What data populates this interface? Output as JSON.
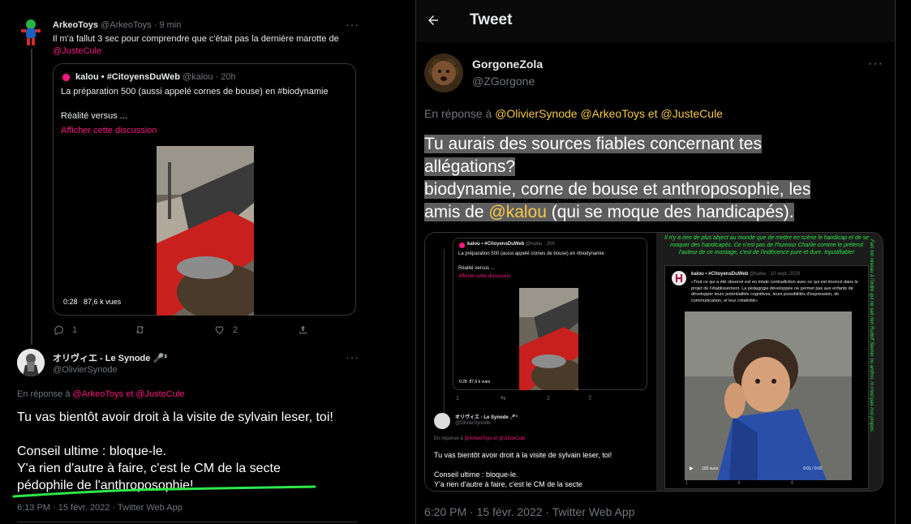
{
  "left": {
    "tweet1": {
      "author": "ArkeoToys",
      "handle": "@ArkeoToys",
      "time": "· 9 min",
      "text": "Il m'a fallut 3 sec pour comprendre que c'était pas la dernière marotte de",
      "mention": "@JusteCule"
    },
    "quote": {
      "author": "kalou • #CitoyensDuWeb",
      "handle": "@kalou · 20h",
      "line1": "La préparation 500 (aussi appelé cornes de bouse) en #biodynamie",
      "line2": "Réalité versus ...",
      "show_thread": "Afficher cette discussion",
      "video_time": "0:28",
      "video_views": "87,6 k vues"
    },
    "actions1": {
      "replies": "1",
      "likes": "2"
    },
    "tweet2": {
      "author": "オリヴィエ - Le Synode 🎤³",
      "handle": "@OlivierSynode",
      "reply_prefix": "En réponse à",
      "reply_m1": "@ArkeoToys",
      "reply_and": "et",
      "reply_m2": "@JusteCule",
      "line1": "Tu vas bientôt avoir droit à la visite de sylvain leser, toi!",
      "line2": "Conseil ultime : bloque-le.",
      "line3": "Y'a rien d'autre à faire, c'est le CM de la secte",
      "line4": "pédophile de l'anthroposophie!",
      "meta": "6:13 PM · 15 févr. 2022 · Twitter Web App"
    }
  },
  "right": {
    "header_title": "Tweet",
    "author": "GorgoneZola",
    "handle": "@ZGorgone",
    "reply_prefix": "En réponse à",
    "reply_m1": "@OlivierSynode",
    "reply_m2": "@ArkeoToys",
    "reply_and": "et",
    "reply_m3": "@JusteCule",
    "text1": "Tu aurais des sources fiables concernant tes",
    "text2": "allégations?",
    "text3": "biodynamie, corne de bouse et anthroposophie, les",
    "text4a": "amis de",
    "text4m": "@kalou",
    "text4b": "(qui se moque des handicapés).",
    "meta": "6:20 PM · 15 févr. 2022 · Twitter Web App",
    "media_left": {
      "q_author": "kalou • #CitoyensDuWeb",
      "q_handle": "@kalou · 20h",
      "q_line1": "La préparation 500 (aussi appelé cornes de bouse) en #biodynamie",
      "q_line2": "Réalité versus ...",
      "q_show": "Afficher cette discussion",
      "video_time": "0:28",
      "video_views": "87,6 k vues",
      "r_replies": "1",
      "r_likes": "2",
      "t_author": "オリヴィエ - Le Synode 🎤³",
      "t_handle": "@OlivierSynode",
      "t_reply": "En réponse à",
      "t_m1": "@ArkeoToys",
      "t_and": "et",
      "t_m2": "@JusteCule",
      "t_line1": "Tu vas bientôt avoir droit à la visite de sylvain leser, toi!",
      "t_line2": "Conseil ultime : bloque-le.",
      "t_line3": "Y'a rien d'autre à faire, c'est le CM de la secte"
    },
    "media_right": {
      "caption": "Il n'y a rien de plus abject au monde que de mettre en scène le handicap et de se moquer des handicapés. Ce n'est pas de l'humour Charlie comme le prétend l'auteur de ce montage, c'est de l'indécence pure et dure. Injustifiable!",
      "side_text": "Fais ton réseau à l'ordre qui ne sait rien Rudolf Steiner ou anthro, ni n'est pas moi propos.",
      "q_author": "kalou • #CitoyensDuWeb",
      "q_handle": "@kalou · 10 sept. 2020",
      "q_text": "«Tout ce qui a été observé est en totale contradiction avec ce qui est énoncé dans le projet de l'établissement. La pédagogie développée ne permet pas aux enfants de développer leurs potentialités cognitives, leurs possibilités d'expression, de communication, et leur créativité»",
      "views": "105 vues",
      "time": "0:01 / 0:02",
      "replies": "1",
      "retweets": "4",
      "likes": "6"
    }
  }
}
